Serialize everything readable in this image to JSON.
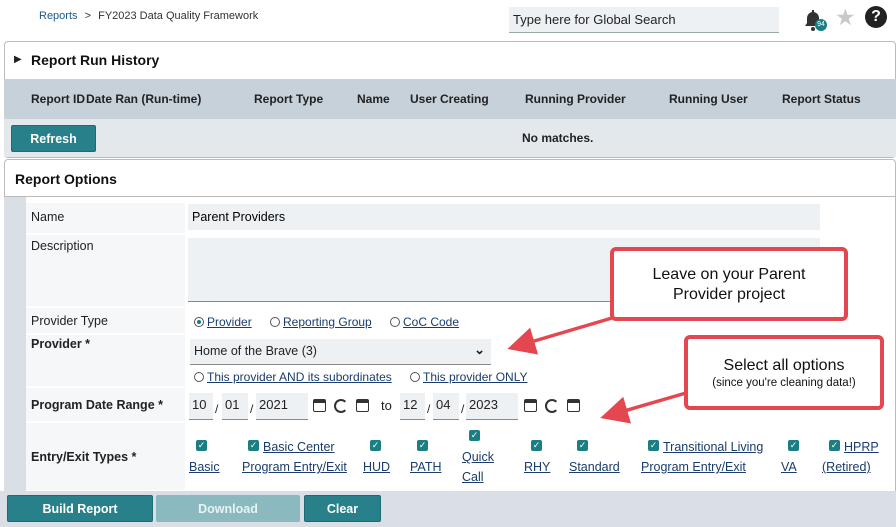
{
  "breadcrumb": {
    "root": "Reports",
    "sep": ">",
    "current": "FY2023 Data Quality Framework"
  },
  "search": {
    "value": "Type here for Global Search"
  },
  "notifications": {
    "count": "94"
  },
  "help_label": "?",
  "run_history": {
    "title": "Report Run History",
    "columns": [
      "Report ID",
      "Date Ran (Run-time)",
      "Report Type",
      "Name",
      "User Creating",
      "Running Provider",
      "Running User",
      "Report Status"
    ],
    "refresh_label": "Refresh",
    "empty_text": "No matches."
  },
  "options": {
    "title": "Report Options",
    "name_label": "Name",
    "name_value": "Parent Providers",
    "description_label": "Description",
    "description_value": "",
    "provider_type_label": "Provider Type",
    "provider_type_options": [
      "Provider",
      "Reporting Group",
      "CoC Code"
    ],
    "provider_label": "Provider *",
    "provider_value": "Home of the Brave (3)",
    "provider_scope_options": [
      "This provider AND its subordinates",
      "This provider ONLY"
    ],
    "date_label": "Program Date Range *",
    "date_from": {
      "month": "10",
      "day": "01",
      "year": "2021"
    },
    "date_to_word": "to",
    "date_to": {
      "month": "12",
      "day": "04",
      "year": "2023"
    },
    "entry_exit_label": "Entry/Exit Types *",
    "entry_exit_types": [
      {
        "line1": "Basic",
        "line2": "",
        "line3": ""
      },
      {
        "line1": "Basic Center",
        "line2": "Program Entry/Exit",
        "line3": ""
      },
      {
        "line1": "HUD",
        "line2": "",
        "line3": ""
      },
      {
        "line1": "PATH",
        "line2": "",
        "line3": ""
      },
      {
        "line1": "Quick",
        "line2": "Call",
        "line3": ""
      },
      {
        "line1": "RHY",
        "line2": "",
        "line3": ""
      },
      {
        "line1": "Standard",
        "line2": "",
        "line3": ""
      },
      {
        "line1": "Transitional Living",
        "line2": "Program Entry/Exit",
        "line3": ""
      },
      {
        "line1": "VA",
        "line2": "",
        "line3": ""
      },
      {
        "line1": "HPRP",
        "line2": "(Retired)",
        "line3": ""
      }
    ]
  },
  "callouts": {
    "parent": {
      "line1": "Leave on your Parent",
      "line2": "Provider project"
    },
    "select": {
      "line1": "Select all options",
      "line2": "(since you're cleaning data!)"
    }
  },
  "footer": {
    "build_label": "Build Report",
    "download_label": "Download",
    "clear_label": "Clear"
  },
  "colors": {
    "accent": "#27808a",
    "callout_border": "#e4474f",
    "header_bg": "#c7d1da"
  }
}
